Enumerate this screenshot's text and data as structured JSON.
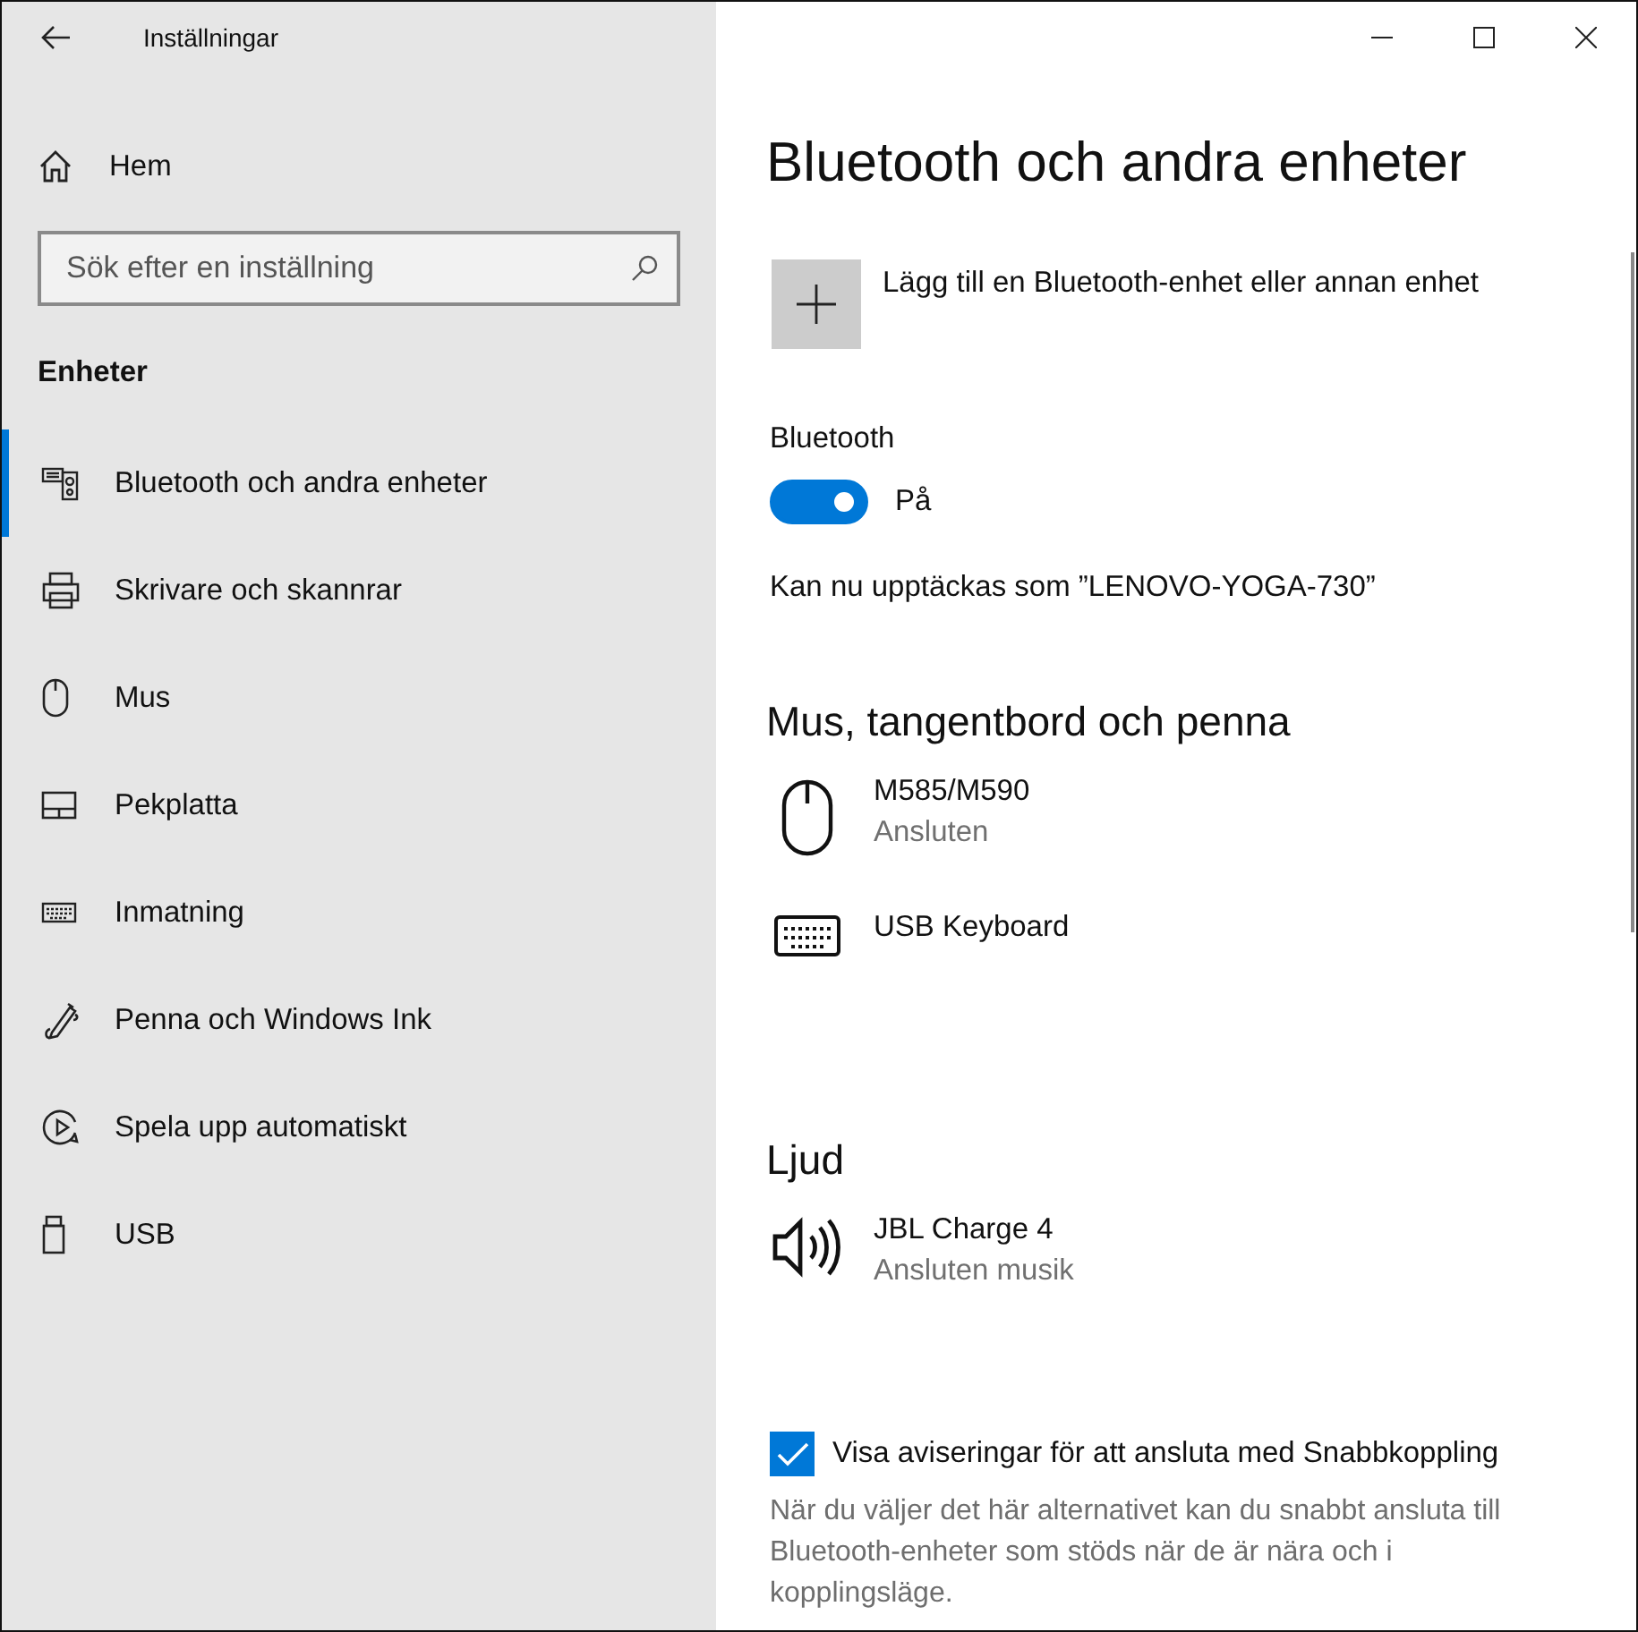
{
  "window": {
    "title": "Inställningar"
  },
  "sidebar": {
    "home": "Hem",
    "search": {
      "placeholder": "Sök efter en inställning"
    },
    "section": "Enheter",
    "items": [
      {
        "label": "Bluetooth och andra enheter",
        "kind": "bluetooth",
        "selected": true
      },
      {
        "label": "Skrivare och skannrar",
        "kind": "printer",
        "selected": false
      },
      {
        "label": "Mus",
        "kind": "mouse",
        "selected": false
      },
      {
        "label": "Pekplatta",
        "kind": "touchpad",
        "selected": false
      },
      {
        "label": "Inmatning",
        "kind": "keyboard",
        "selected": false
      },
      {
        "label": "Penna och Windows Ink",
        "kind": "pen",
        "selected": false
      },
      {
        "label": "Spela upp automatiskt",
        "kind": "autoplay",
        "selected": false
      },
      {
        "label": "USB",
        "kind": "usb",
        "selected": false
      }
    ]
  },
  "content": {
    "heading": "Bluetooth och andra enheter",
    "add_device": "Lägg till en Bluetooth-enhet eller annan enhet",
    "bluetooth": {
      "label": "Bluetooth",
      "on": true,
      "state_text": "På"
    },
    "discoverable": "Kan nu upptäckas som ”LENOVO-YOGA-730”",
    "sections": [
      {
        "title": "Mus, tangentbord och penna",
        "devices": [
          {
            "name": "M585/M590",
            "status": "Ansluten",
            "kind": "mouse"
          },
          {
            "name": "USB Keyboard",
            "kind": "keyboard"
          }
        ]
      },
      {
        "title": "Ljud",
        "devices": [
          {
            "name": "JBL Charge 4",
            "status": "Ansluten musik",
            "kind": "speaker"
          }
        ]
      }
    ],
    "swift_pair": {
      "label": "Visa aviseringar för att ansluta med Snabbkoppling",
      "checked": true,
      "description": "När du väljer det här alternativet kan du snabbt ansluta till Bluetooth-enheter som stöds när de är nära och i kopplingsläge."
    }
  }
}
